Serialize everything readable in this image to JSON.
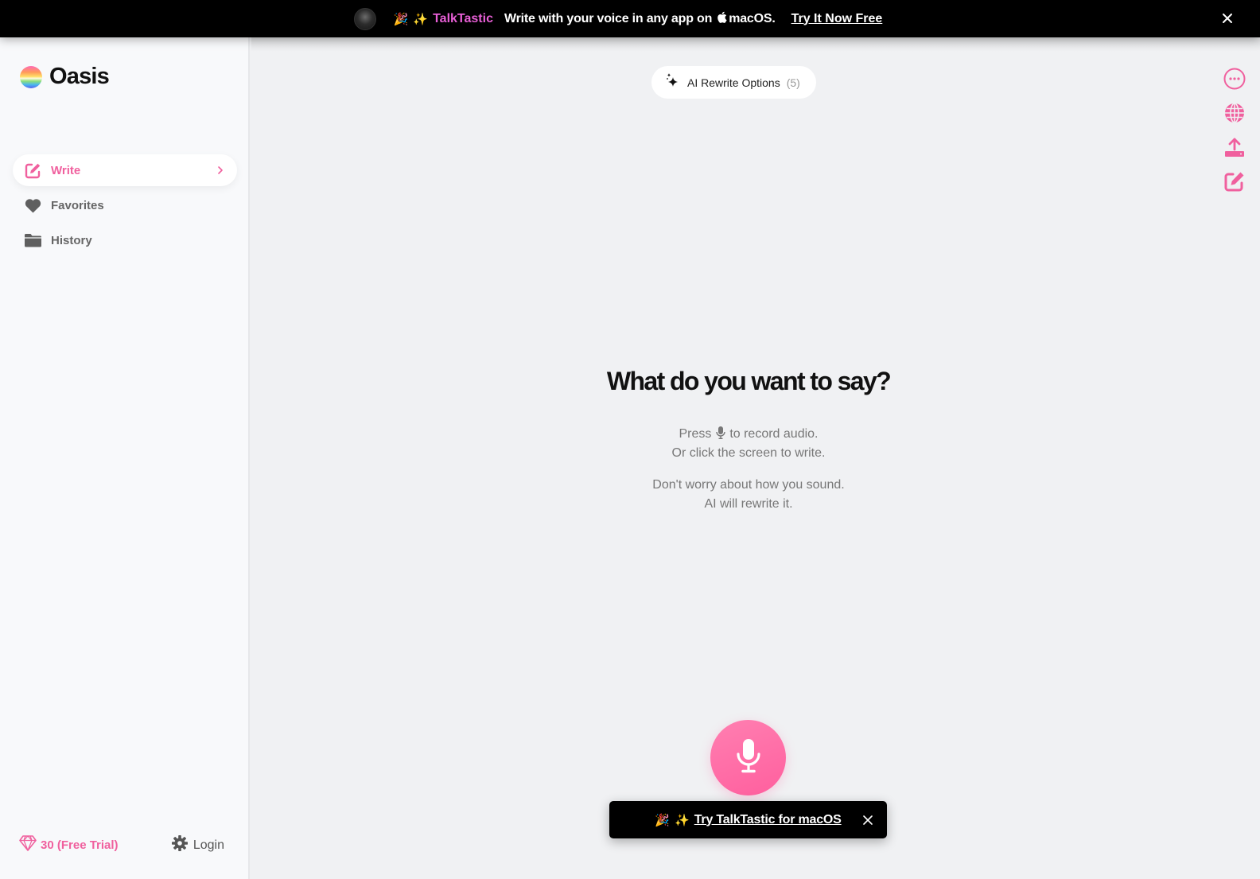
{
  "banner": {
    "emoji_party": "🎉",
    "emoji_sparkle": "✨",
    "brand": "TalkTastic",
    "text_before": "Write with your voice in any app on",
    "apple_glyph": "",
    "text_after": "macOS.",
    "link": "Try It Now Free",
    "close_icon": "close-icon"
  },
  "sidebar": {
    "app_name": "Oasis",
    "items": [
      {
        "label": "Write",
        "icon": "edit-icon",
        "active": true
      },
      {
        "label": "Favorites",
        "icon": "heart-icon",
        "active": false
      },
      {
        "label": "History",
        "icon": "folder-icon",
        "active": false
      }
    ],
    "credits": "30 (Free Trial)",
    "login": "Login"
  },
  "main": {
    "rewrite_label": "AI Rewrite Options",
    "rewrite_count": "(5)",
    "headline": "What do you want to say?",
    "line1_before": "Press",
    "line1_after": "to record audio.",
    "line2": "Or click the screen to write.",
    "line3": "Don't worry about how you sound.",
    "line4": "AI will rewrite it.",
    "tools": [
      "more-icon",
      "globe-icon",
      "upload-icon",
      "edit-icon"
    ]
  },
  "toast": {
    "emoji_party": "🎉",
    "emoji_sparkle": "✨",
    "link": "Try TalkTastic for macOS"
  },
  "colors": {
    "accent": "#f0609e",
    "brand_pink": "#e85fd6",
    "banner_bg": "#000000",
    "main_bg": "#f0f1f3",
    "sidebar_bg": "#f8f9fb"
  }
}
